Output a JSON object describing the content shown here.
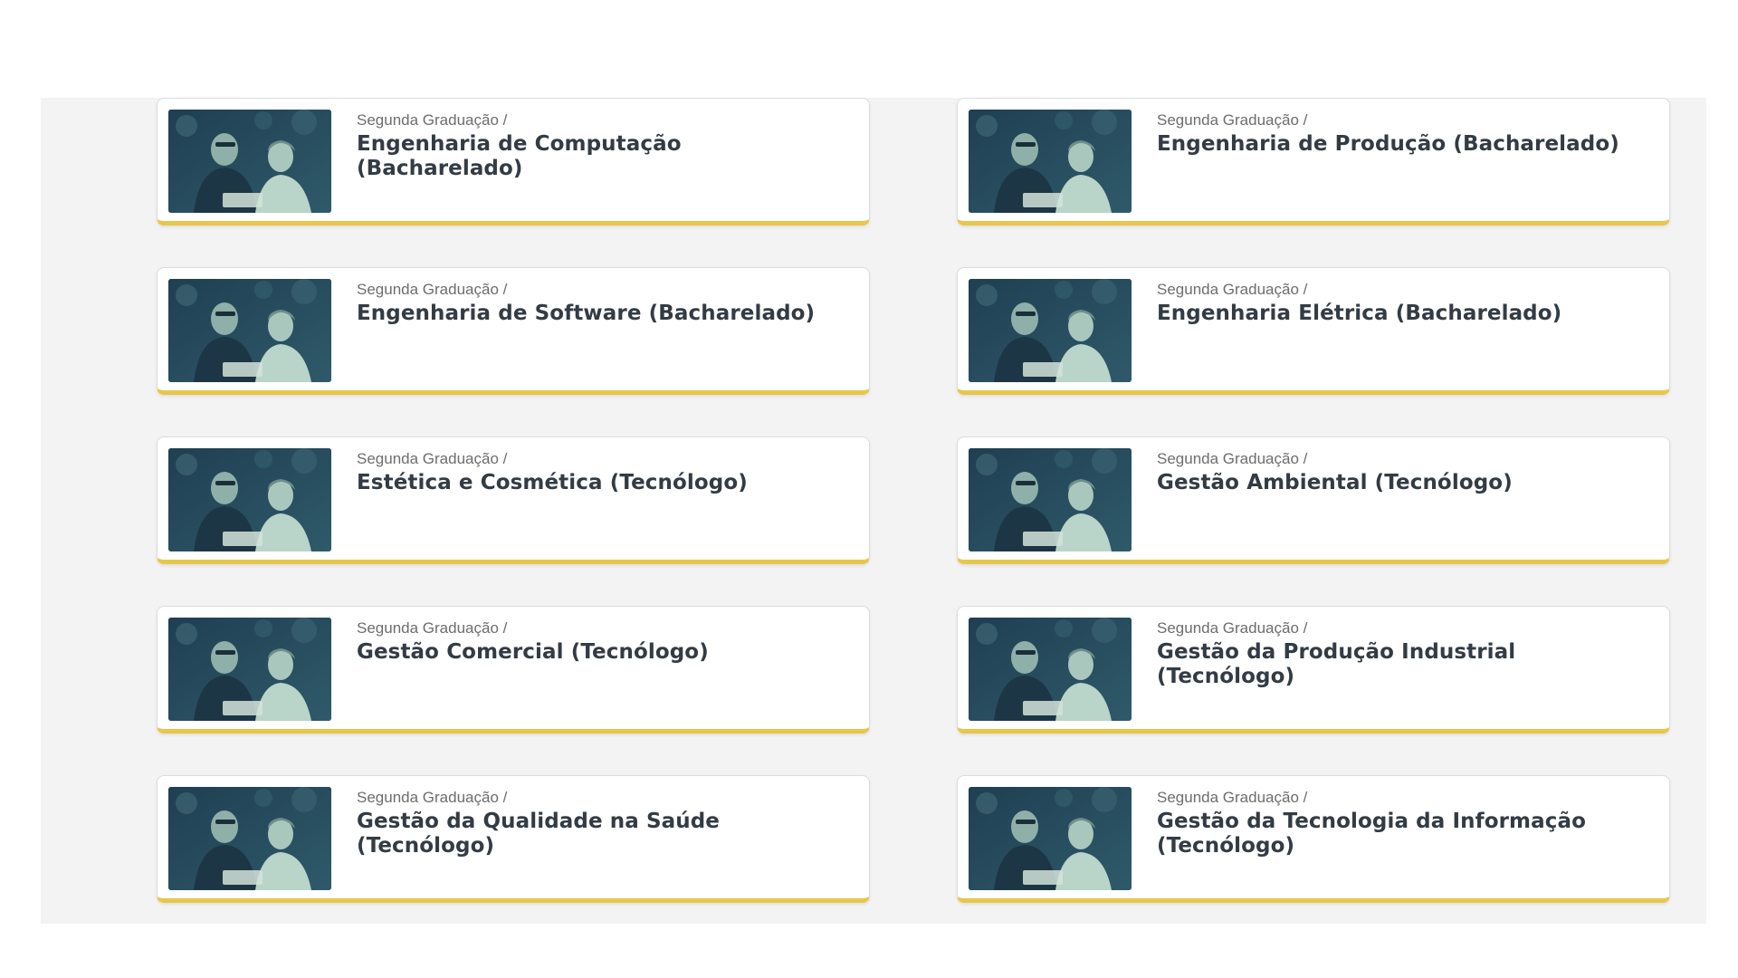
{
  "colors": {
    "accent": "#e8c64a",
    "title_text": "#333b44",
    "crumb_text": "#6d6d6d",
    "panel_bg": "#f3f3f3",
    "thumb_tint": "#24485a"
  },
  "thumbnail_icon": "students-photo",
  "cards": [
    {
      "crumb": "Segunda Graduação /",
      "title": "Engenharia de Computação (Bacharelado)"
    },
    {
      "crumb": "Segunda Graduação /",
      "title": "Engenharia de Produção (Bacharelado)"
    },
    {
      "crumb": "Segunda Graduação /",
      "title": "Engenharia de Software (Bacharelado)"
    },
    {
      "crumb": "Segunda Graduação /",
      "title": "Engenharia Elétrica (Bacharelado)"
    },
    {
      "crumb": "Segunda Graduação /",
      "title": "Estética e Cosmética (Tecnólogo)"
    },
    {
      "crumb": "Segunda Graduação /",
      "title": "Gestão Ambiental (Tecnólogo)"
    },
    {
      "crumb": "Segunda Graduação /",
      "title": "Gestão Comercial (Tecnólogo)"
    },
    {
      "crumb": "Segunda Graduação /",
      "title": "Gestão da Produção Industrial (Tecnólogo)"
    },
    {
      "crumb": "Segunda Graduação /",
      "title": "Gestão da Qualidade na Saúde (Tecnólogo)"
    },
    {
      "crumb": "Segunda Graduação /",
      "title": "Gestão da Tecnologia da Informação (Tecnólogo)"
    }
  ]
}
